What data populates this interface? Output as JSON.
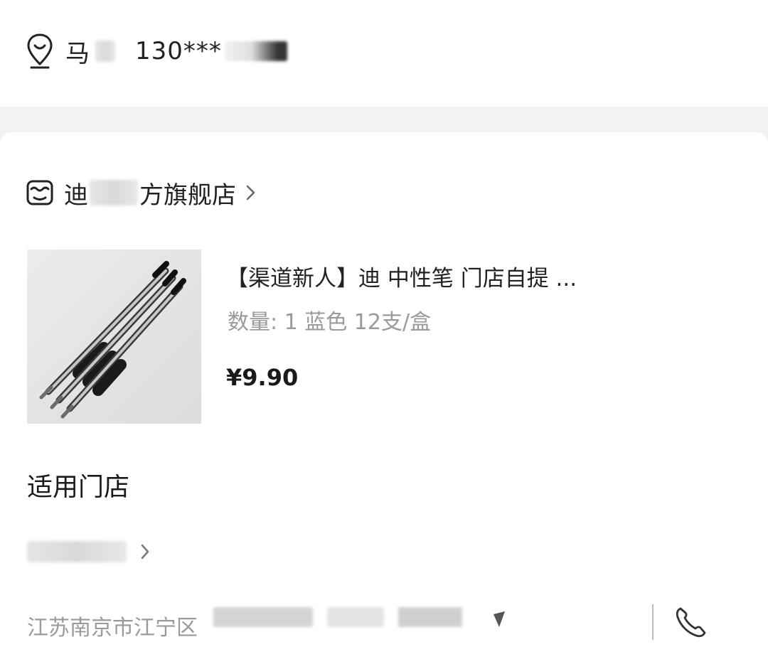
{
  "address": {
    "name": "马",
    "phone": "130***"
  },
  "shop": {
    "name_prefix": "迪",
    "name_suffix": "方旗舰店"
  },
  "product": {
    "title": "【渠道新人】迪 中性笔 门店自提 ...",
    "spec": "数量: 1 蓝色 12支/盒",
    "price": "¥9.90"
  },
  "stores": {
    "title": "适用门店",
    "address": "江苏南京市江宁区"
  },
  "icons": {
    "location": "location-pin-icon",
    "shop": "shop-icon",
    "chevron": "chevron-right-icon",
    "phone": "phone-icon"
  }
}
